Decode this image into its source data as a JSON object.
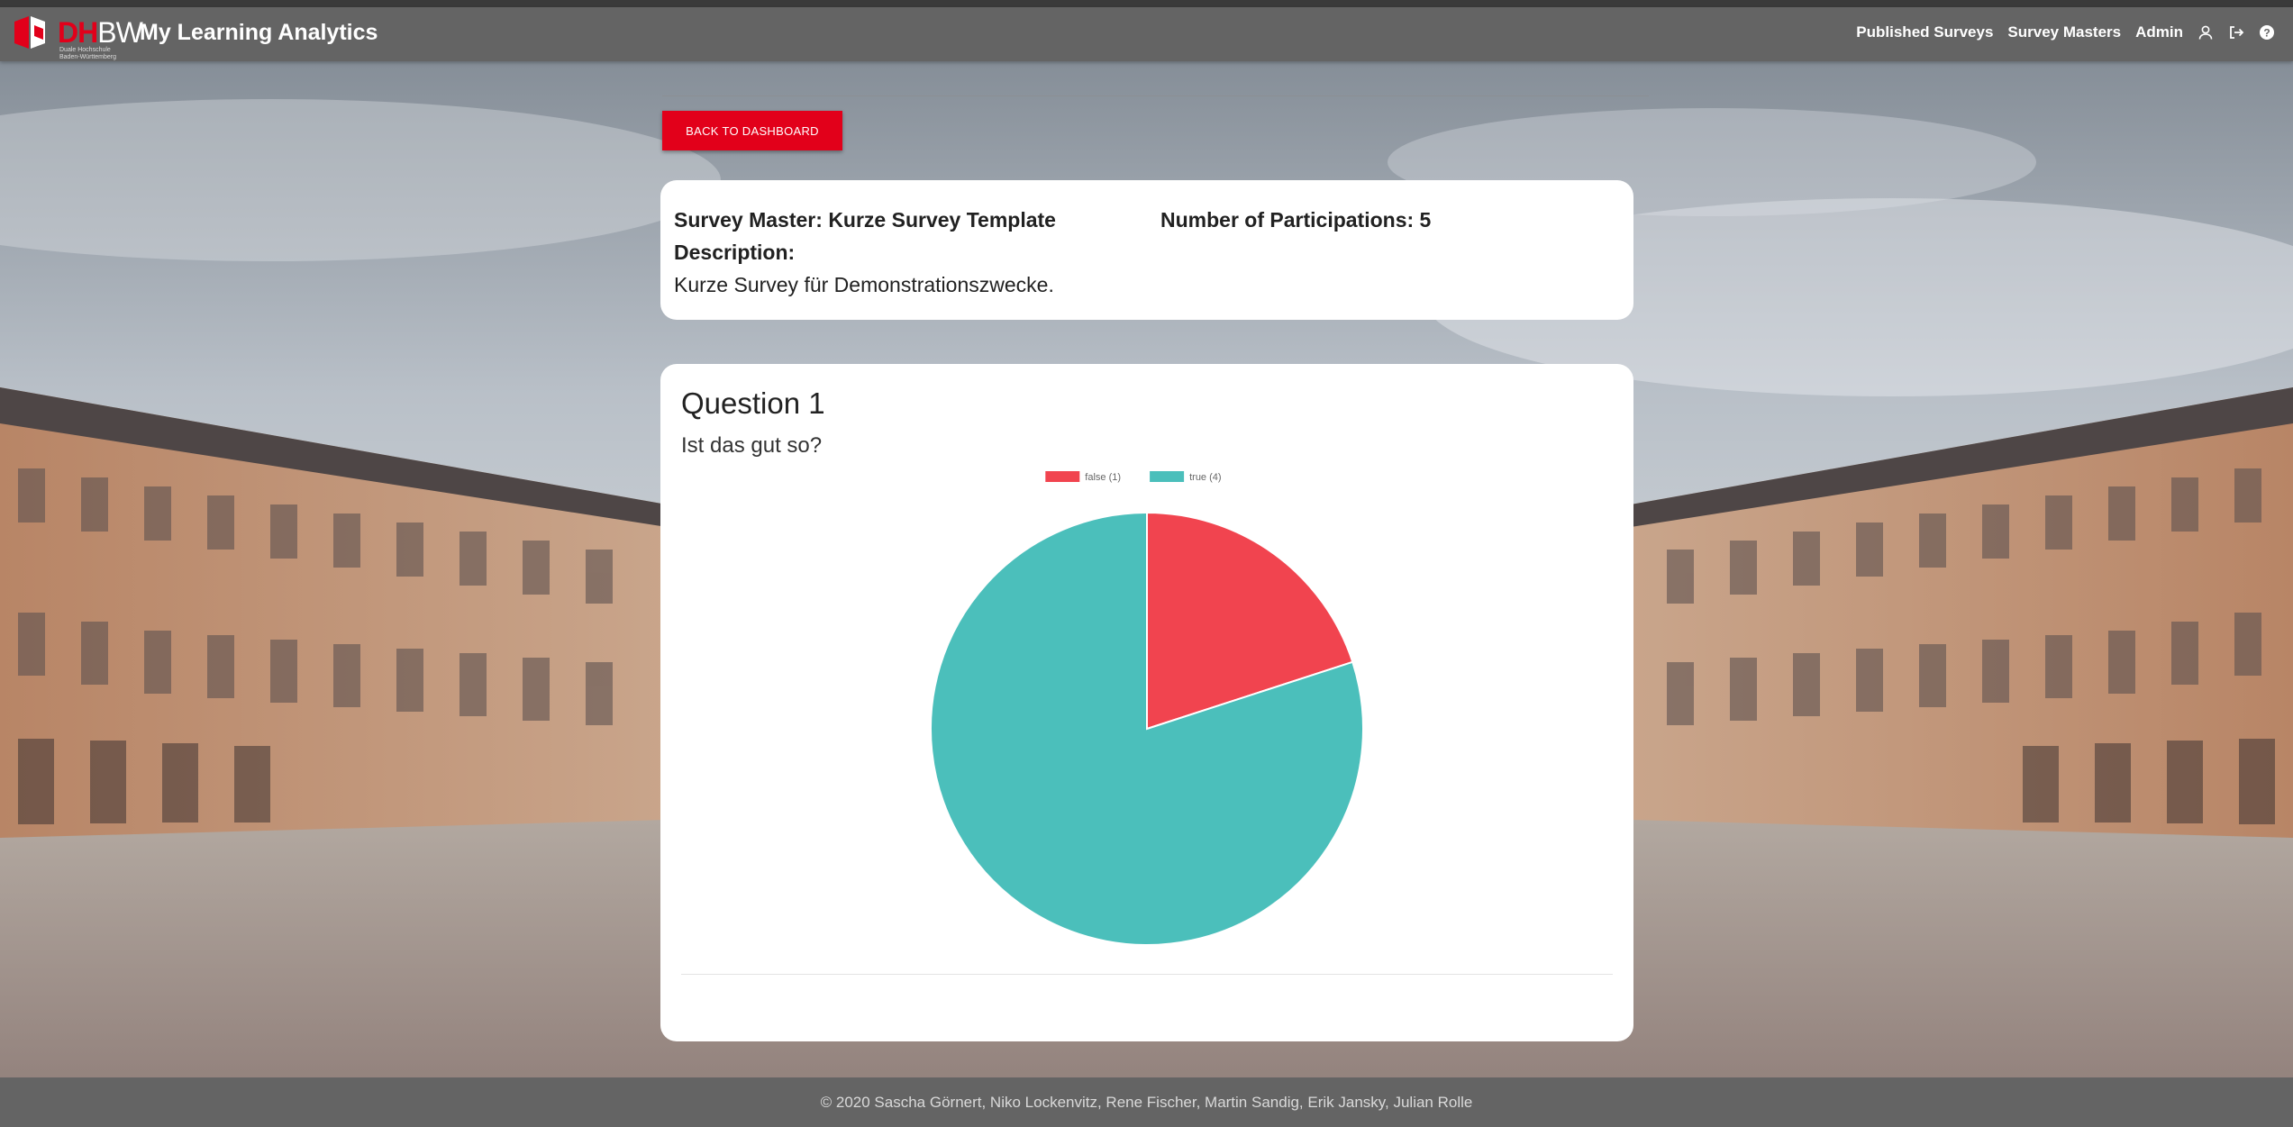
{
  "header": {
    "logo": {
      "primary": "DH",
      "secondary": "BW",
      "subtitle": "Duale Hochschule Baden-Württemberg"
    },
    "app_title": "My Learning Analytics",
    "nav": {
      "published_surveys": "Published Surveys",
      "survey_masters": "Survey Masters",
      "admin": "Admin"
    },
    "icons": [
      "user-icon",
      "logout-icon",
      "help-icon"
    ]
  },
  "actions": {
    "back_label": "BACK TO DASHBOARD"
  },
  "survey": {
    "master_label": "Survey Master:",
    "master_name": "Kurze Survey Template",
    "participations_label": "Number of Participations:",
    "participations_value": "5",
    "description_label": "Description:",
    "description": "Kurze Survey für Demonstrationszwecke."
  },
  "questions": [
    {
      "title": "Question 1",
      "text": "Ist das gut so?"
    }
  ],
  "chart_data": {
    "type": "pie",
    "categories": [
      "false (1)",
      "true (4)"
    ],
    "values": [
      1,
      4
    ],
    "colors": [
      "#f1444f",
      "#4bbfbb"
    ],
    "legend_position": "top"
  },
  "footer": {
    "text": "© 2020 Sascha Görnert, Niko Lockenvitz, Rene Fischer, Martin Sandig, Erik Jansky, Julian Rolle"
  },
  "colors": {
    "navbar": "#646464",
    "accent": "#e2001a",
    "card": "#ffffff"
  }
}
